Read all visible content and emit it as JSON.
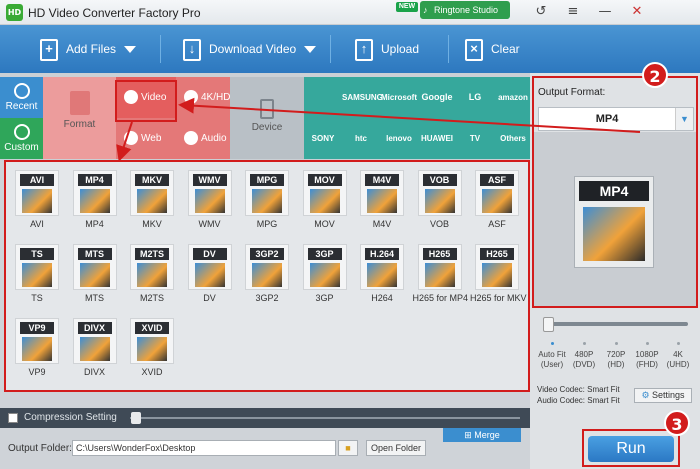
{
  "window": {
    "title": "HD Video Converter Factory Pro",
    "app_icon": "HD",
    "new_badge": "NEW",
    "ringtone_studio": "Ringtone Studio",
    "controls": [
      "↺",
      "≡",
      "—",
      "✕"
    ]
  },
  "toolbar": {
    "add_files": "Add Files",
    "download_video": "Download Video",
    "upload": "Upload",
    "clear": "Clear"
  },
  "categories": {
    "recent": "Recent",
    "custom": "Custom",
    "format": "Format",
    "video": "Video",
    "hd": "4K/HD",
    "web": "Web",
    "audio": "Audio",
    "device": "Device"
  },
  "brands": [
    "",
    "SAMSUNG",
    "Microsoft",
    "Google",
    "LG",
    "amazon",
    "SONY",
    "htc",
    "lenovo",
    "HUAWEI",
    "TV",
    "Others"
  ],
  "formats": [
    {
      "tag": "AVI",
      "label": "AVI"
    },
    {
      "tag": "MP4",
      "label": "MP4"
    },
    {
      "tag": "MKV",
      "label": "MKV"
    },
    {
      "tag": "WMV",
      "label": "WMV"
    },
    {
      "tag": "MPG",
      "label": "MPG"
    },
    {
      "tag": "MOV",
      "label": "MOV"
    },
    {
      "tag": "M4V",
      "label": "M4V"
    },
    {
      "tag": "VOB",
      "label": "VOB"
    },
    {
      "tag": "ASF",
      "label": "ASF"
    },
    {
      "tag": "TS",
      "label": "TS"
    },
    {
      "tag": "MTS",
      "label": "MTS"
    },
    {
      "tag": "M2TS",
      "label": "M2TS"
    },
    {
      "tag": "DV",
      "label": "DV"
    },
    {
      "tag": "3GP2",
      "label": "3GP2"
    },
    {
      "tag": "3GP",
      "label": "3GP"
    },
    {
      "tag": "H.264",
      "label": "H264"
    },
    {
      "tag": "H265",
      "label": "H265 for MP4"
    },
    {
      "tag": "H265",
      "label": "H265 for MKV"
    },
    {
      "tag": "VP9",
      "label": "VP9"
    },
    {
      "tag": "DIVX",
      "label": "DIVX"
    },
    {
      "tag": "XVID",
      "label": "XVID"
    }
  ],
  "output_format": {
    "label": "Output Format:",
    "value": "MP4",
    "preview_tag": "MP4"
  },
  "quality": {
    "options": [
      {
        "top": "Auto Fit",
        "bottom": "(User)"
      },
      {
        "top": "480P",
        "bottom": "(DVD)"
      },
      {
        "top": "720P",
        "bottom": "(HD)"
      },
      {
        "top": "1080P",
        "bottom": "(FHD)"
      },
      {
        "top": "4K",
        "bottom": "(UHD)"
      }
    ]
  },
  "codec": {
    "video": "Video Codec: Smart Fit",
    "audio": "Audio Codec: Smart Fit",
    "settings": "Settings"
  },
  "compression": {
    "label": "Compression Setting"
  },
  "merge": "Merge",
  "output": {
    "label": "Output Folder:",
    "path": "C:\\Users\\WonderFox\\Desktop",
    "open_folder": "Open Folder"
  },
  "run": "Run",
  "callouts": [
    "2",
    "3"
  ]
}
